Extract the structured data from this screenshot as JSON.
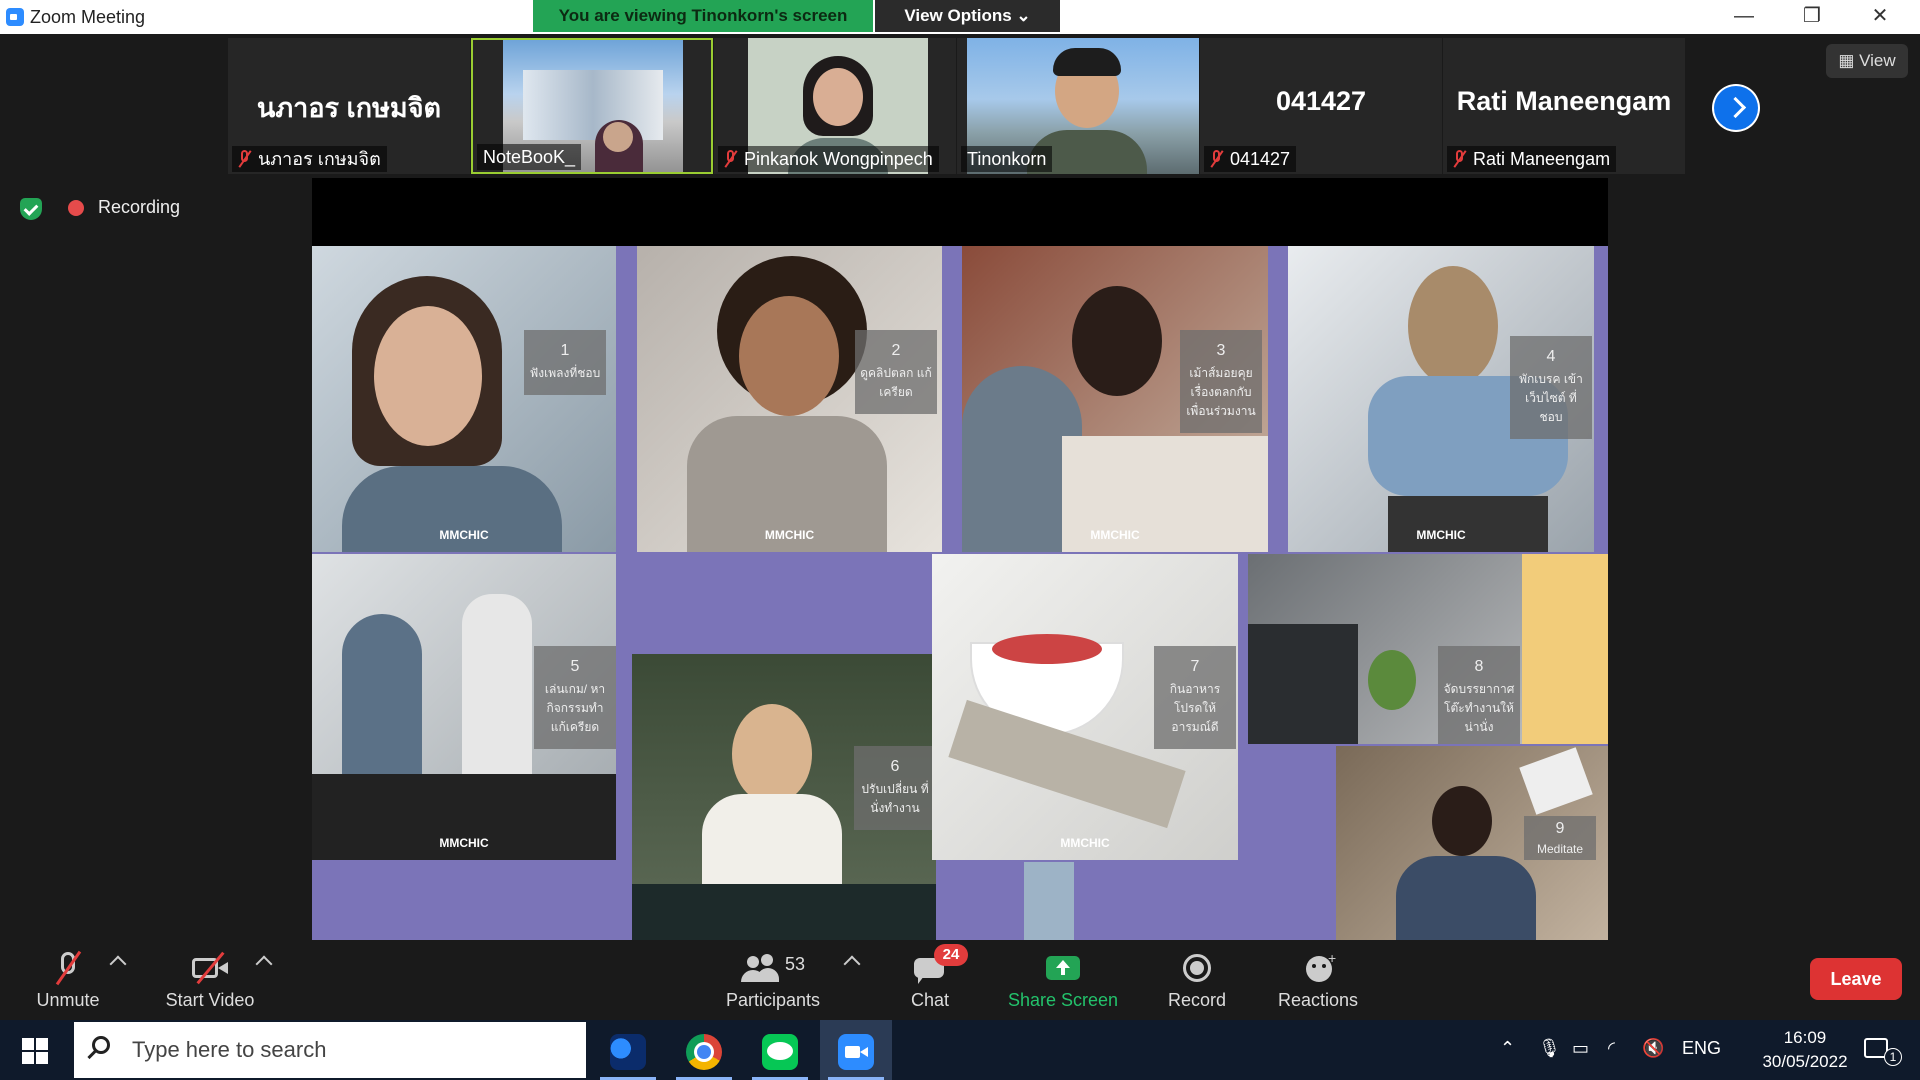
{
  "window": {
    "title": "Zoom Meeting",
    "viewing_banner": "You are viewing Tinonkorn's screen",
    "view_options": "View Options ⌄",
    "minimize": "—",
    "restore": "❐",
    "close": "✕"
  },
  "participants_strip": {
    "tiles": [
      {
        "display_name": "นภาอร เกษมจิต",
        "label": "นภาอร เกษมจิต",
        "muted": true,
        "video": false
      },
      {
        "display_name": "",
        "label": "NoteBooK_",
        "muted": false,
        "video": true
      },
      {
        "display_name": "",
        "label": "Pinkanok Wongpinpech",
        "muted": true,
        "video": true
      },
      {
        "display_name": "",
        "label": "Tinonkorn",
        "muted": false,
        "video": true
      },
      {
        "display_name": "041427",
        "label": "041427",
        "muted": true,
        "video": false
      },
      {
        "display_name": "Rati Maneengam",
        "label": "Rati Maneengam",
        "muted": true,
        "video": false
      }
    ],
    "view_button": "View"
  },
  "status": {
    "recording": "Recording"
  },
  "shared_screen": {
    "items": [
      {
        "num": "1",
        "text": "ฟังเพลงที่ชอบ",
        "brand": "MMCHIC"
      },
      {
        "num": "2",
        "text": "ดูคลิปตลก แก้เครียด",
        "brand": "MMCHIC"
      },
      {
        "num": "3",
        "text": "เม้าส์มอยคุย เรื่องตลกกับ เพื่อนร่วมงาน",
        "brand": "MMCHIC"
      },
      {
        "num": "4",
        "text": "พักเบรค เข้าเว็บไซต์ ที่ชอบ",
        "brand": "MMCHIC"
      },
      {
        "num": "5",
        "text": "เล่นเกม/ หากิจกรรมทำ แก้เครียด",
        "brand": "MMCHIC"
      },
      {
        "num": "6",
        "text": "ปรับเปลี่ยน ที่นั่งทำงาน",
        "brand": ""
      },
      {
        "num": "7",
        "text": "กินอาหาร โปรดให้ อารมณ์ดี",
        "brand": "MMCHIC"
      },
      {
        "num": "8",
        "text": "จัดบรรยากาศ โต๊ะทำงานให้ น่านั่ง",
        "brand": ""
      },
      {
        "num": "9",
        "text": "Meditate",
        "brand": ""
      }
    ]
  },
  "toolbar": {
    "unmute": "Unmute",
    "start_video": "Start Video",
    "participants": "Participants",
    "participants_count": "53",
    "chat": "Chat",
    "chat_badge": "24",
    "share_screen": "Share Screen",
    "record": "Record",
    "reactions": "Reactions",
    "leave": "Leave"
  },
  "taskbar": {
    "search_placeholder": "Type here to search",
    "language": "ENG",
    "time": "16:09",
    "date": "30/05/2022",
    "notifications": "1"
  },
  "colors": {
    "accent_green": "#23a455",
    "zoom_blue": "#0e71eb",
    "leave_red": "#dd3333",
    "slide_purple": "#7b74b8"
  }
}
